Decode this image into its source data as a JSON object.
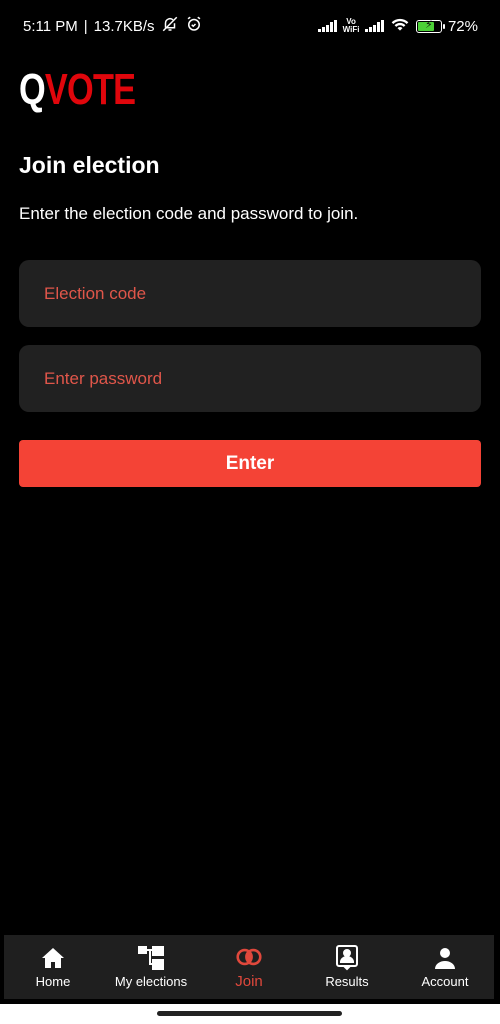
{
  "status_bar": {
    "time": "5:11 PM",
    "separator": "|",
    "net_speed": "13.7KB/s",
    "icons": [
      "bell-muted-icon",
      "alarm-icon",
      "signal-icon",
      "vowifi-icon",
      "signal-icon",
      "wifi-icon",
      "battery-charging-icon"
    ],
    "vowifi_top": "Vo",
    "vowifi_bottom": "WiFi",
    "battery_percent": "72%",
    "battery_level": 0.72
  },
  "app": {
    "logo_q": "Q",
    "logo_vote": "VOTE",
    "brand_color": "#e0060c"
  },
  "page": {
    "title": "Join election",
    "subtitle": "Enter the election code and password to join."
  },
  "form": {
    "code_placeholder": "Election code",
    "code_value": "",
    "password_placeholder": "Enter password",
    "password_value": "",
    "submit_label": "Enter",
    "accent_color": "#f44336"
  },
  "bottom_nav": {
    "items": [
      {
        "label": "Home",
        "icon": "home-icon",
        "active": false
      },
      {
        "label": "My elections",
        "icon": "hierarchy-icon",
        "active": false
      },
      {
        "label": "Join",
        "icon": "join-rings-icon",
        "active": true
      },
      {
        "label": "Results",
        "icon": "results-badge-icon",
        "active": false
      },
      {
        "label": "Account",
        "icon": "person-icon",
        "active": false
      }
    ]
  }
}
